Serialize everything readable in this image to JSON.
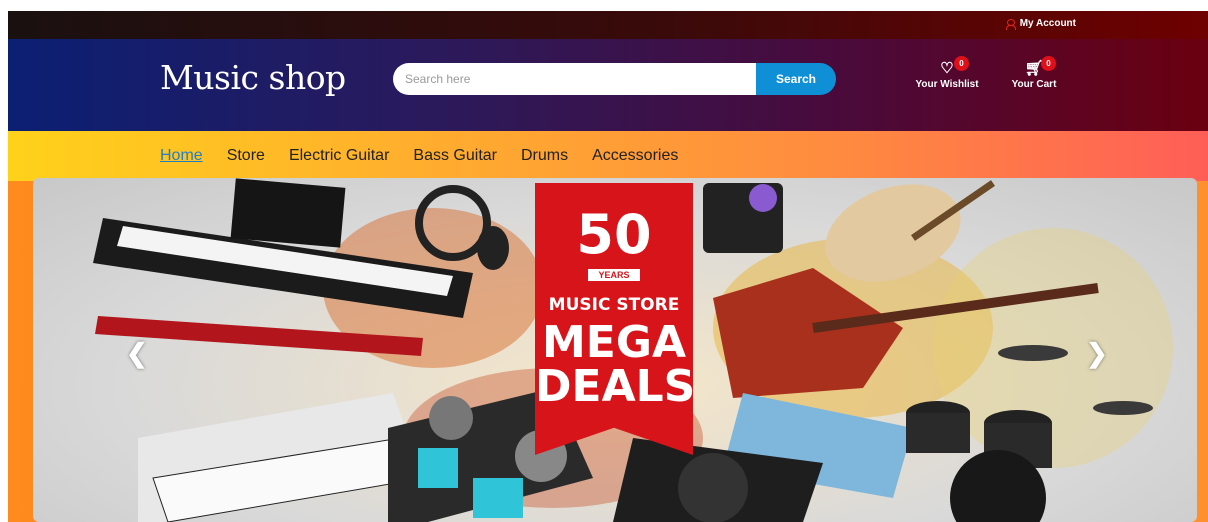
{
  "topbar": {
    "account_label": "My Account"
  },
  "header": {
    "logo": "Music shop",
    "search": {
      "placeholder": "Search here",
      "button_label": "Search"
    },
    "wishlist": {
      "label": "Your Wishlist",
      "count": "0"
    },
    "cart": {
      "label": "Your Cart",
      "count": "0"
    }
  },
  "nav": {
    "items": [
      {
        "label": "Home",
        "active": true
      },
      {
        "label": "Store"
      },
      {
        "label": "Electric Guitar"
      },
      {
        "label": "Bass Guitar"
      },
      {
        "label": "Drums"
      },
      {
        "label": "Accessories"
      }
    ]
  },
  "banner": {
    "badge_number": "50",
    "badge_years": "YEARS",
    "line1": "MUSIC STORE",
    "line2": "MEGA",
    "line3": "DEALS",
    "prev_icon": "chevron-left-icon",
    "next_icon": "chevron-right-icon"
  },
  "colors": {
    "accent": "#0f8fd6",
    "badge": "#e0101b",
    "nav_active": "#1f80c8",
    "ribbon": "#d8141b"
  }
}
